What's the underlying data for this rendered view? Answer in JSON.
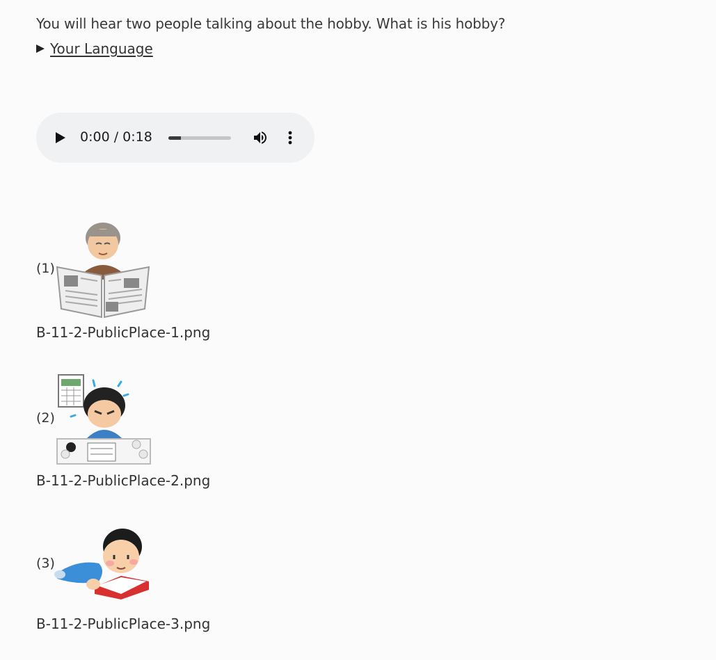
{
  "question": {
    "text": "You will hear two people talking about the hobby. What is his hobby?"
  },
  "details": {
    "summary_label": "Your Language"
  },
  "audio": {
    "time_text": "0:00 / 0:18",
    "progress_fraction": 0.2
  },
  "options": [
    {
      "number": "(1)",
      "filename": "B-11-2-PublicPlace-1.png",
      "image_icon": "reading-newspaper-icon"
    },
    {
      "number": "(2)",
      "filename": "B-11-2-PublicPlace-2.png",
      "image_icon": "studying-at-desk-icon"
    },
    {
      "number": "(3)",
      "filename": "B-11-2-PublicPlace-3.png",
      "image_icon": "reading-book-icon"
    }
  ],
  "colors": {
    "background": "#fbfbfb",
    "text": "#333333",
    "player_bg": "#f0f1f2"
  }
}
